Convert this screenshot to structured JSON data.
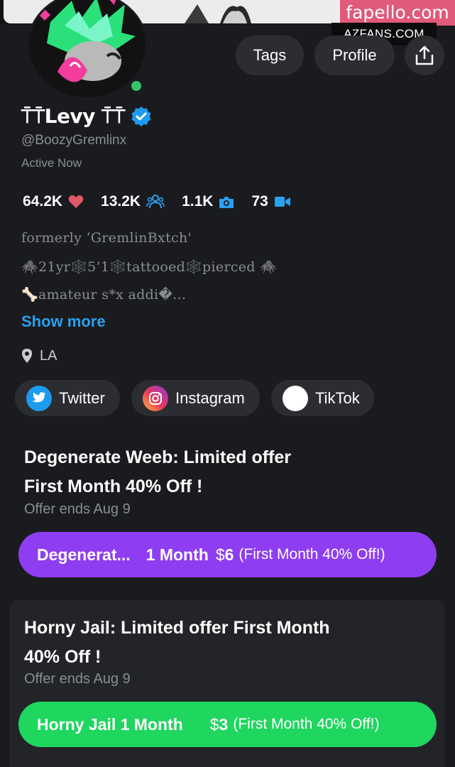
{
  "watermarks": {
    "primary": "fapello.com",
    "secondary": "AZFANS.COM"
  },
  "header": {
    "tags_label": "Tags",
    "profile_label": "Profile",
    "share_icon": "share-icon"
  },
  "profile": {
    "display_name": "⍑⍑Levy ⍑⍑",
    "handle": "@BoozyGremlinx",
    "status": "Active Now",
    "verified": true
  },
  "stats": [
    {
      "value": "64.2K",
      "icon": "heart-icon",
      "color": "#e05a6a"
    },
    {
      "value": "13.2K",
      "icon": "users-icon",
      "color": "#2aa0f0"
    },
    {
      "value": "1.1K",
      "icon": "camera-icon",
      "color": "#2aa0f0"
    },
    {
      "value": "73",
      "icon": "video-icon",
      "color": "#2aa0f0"
    }
  ],
  "bio": {
    "line1": "formerly ‘GremlinBxtch'",
    "line2": "🕷️21yr🕸️5’1🕸️tattooed🕸️pierced 🕷️",
    "line3": "🦴amateur s*x addi�...",
    "show_more": "Show more"
  },
  "location": "LA",
  "socials": [
    {
      "label": "Twitter",
      "icon": "twitter-icon"
    },
    {
      "label": "Instagram",
      "icon": "instagram-icon"
    },
    {
      "label": "TikTok",
      "icon": "tiktok-icon"
    }
  ],
  "offers": [
    {
      "title_line1": "Degenerate Weeb: Limited offer",
      "title_line2": "First Month 40% Off !",
      "ends": "Offer ends Aug 9",
      "button_name": "Degenerat...",
      "button_duration": "1 Month",
      "button_currency": "$",
      "button_price": "6",
      "button_note": "(First Month 40% Off!)",
      "color": "#8e3ef0"
    },
    {
      "title_line1": "Horny Jail: Limited offer First Month",
      "title_line2": "40% Off !",
      "ends": "Offer ends Aug 9",
      "button_name": "Horny Jail 1 Month",
      "button_currency": "$",
      "button_price": "3",
      "button_note": "(First Month 40% Off!)",
      "color": "#1fd65f"
    }
  ],
  "colors": {
    "background": "#1a1b1e",
    "accent": "#2aa0f0",
    "online": "#3ac26a"
  }
}
